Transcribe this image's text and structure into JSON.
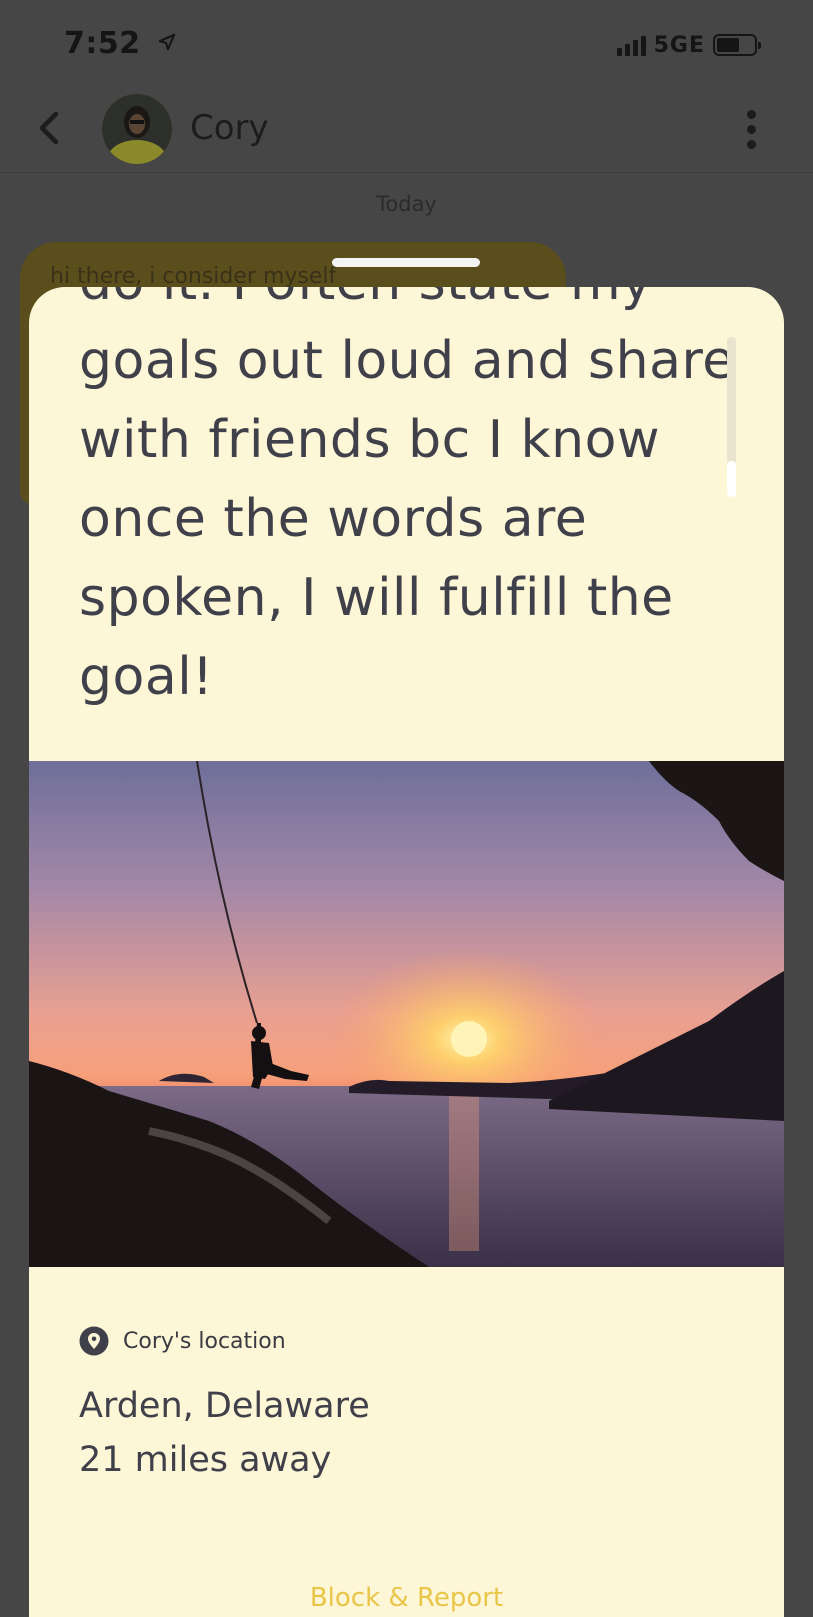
{
  "status_bar": {
    "time": "7:52",
    "network": "5GE",
    "signal_bars": 4,
    "battery_level": 0.55
  },
  "header": {
    "back_icon": "chevron-left-icon",
    "contact_name": "Cory",
    "menu_icon": "more-vertical-icon"
  },
  "chat": {
    "date_divider": "Today",
    "message_preview": "hi there, i consider myself"
  },
  "sheet": {
    "goal_text": "do it. I often state my goals out loud and share with friends bc I know once the words are spoken, I will fulfill the goal!",
    "photo_icon": "sunset-climber-photo",
    "location_icon": "location-pin-icon",
    "location_label": "Cory's location",
    "place": "Arden, Delaware",
    "distance": "21 miles away",
    "block_report_label": "Block & Report"
  },
  "colors": {
    "sheet_bg": "#fdf6d7",
    "text": "#40404a",
    "accent": "#e9c548",
    "overlay": "#464646"
  }
}
